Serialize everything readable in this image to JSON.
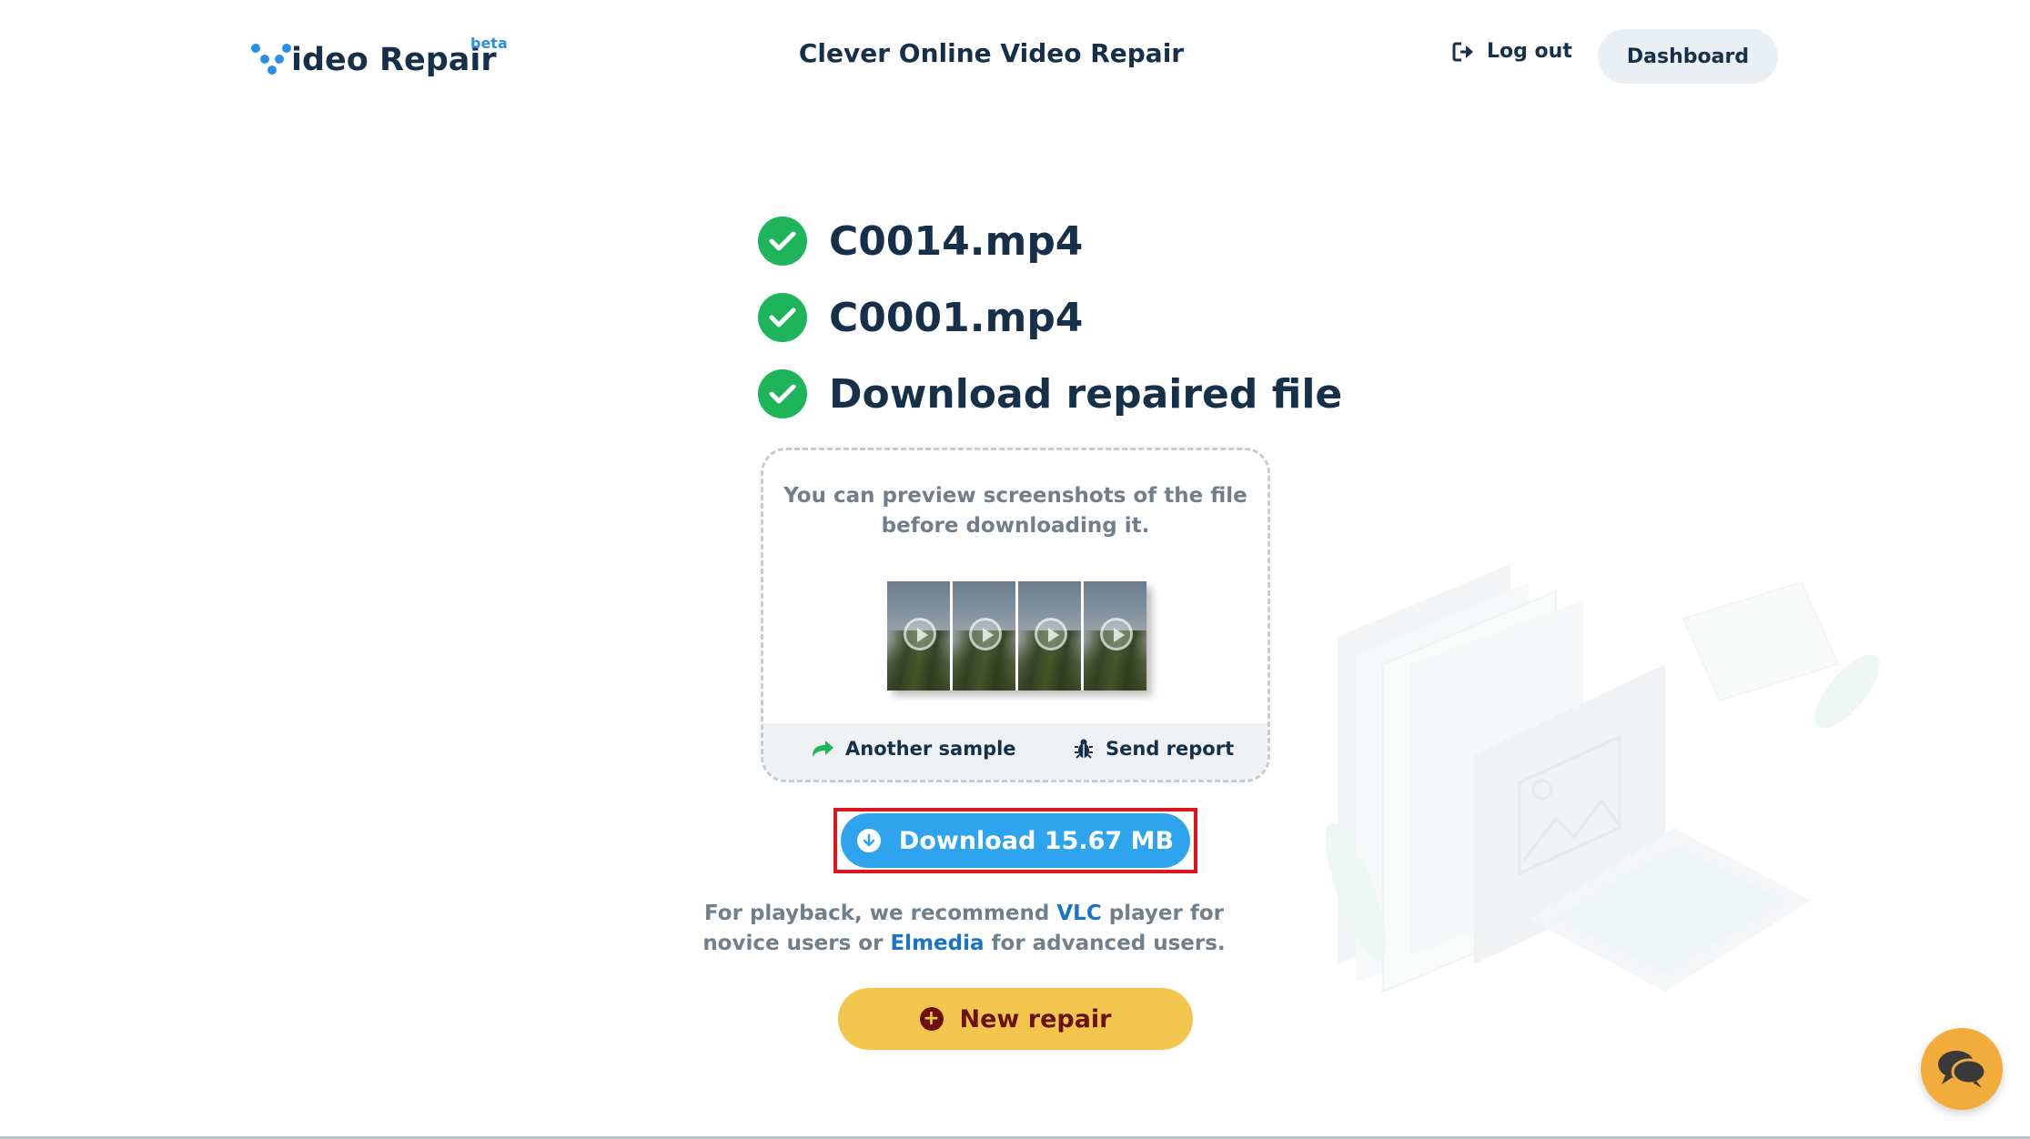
{
  "header": {
    "logo_text": "ideo Repair",
    "logo_beta": "beta",
    "title": "Clever Online Video Repair",
    "logout_label": "Log out",
    "dashboard_label": "Dashboard"
  },
  "steps": [
    {
      "label": "C0014.mp4",
      "status": "done"
    },
    {
      "label": "C0001.mp4",
      "status": "done"
    },
    {
      "label": "Download repaired file",
      "status": "done"
    }
  ],
  "preview": {
    "text_line1": "You can preview screenshots of the file",
    "text_line2": "before downloading it.",
    "another_sample_label": "Another sample",
    "send_report_label": "Send report"
  },
  "download": {
    "label": "Download 15.67 MB"
  },
  "recommend": {
    "part1": "For playback, we recommend ",
    "vlc": "VLC",
    "part2": " player for",
    "part3": "novice users or ",
    "elmedia": "Elmedia",
    "part4": " for advanced users."
  },
  "new_repair": {
    "label": "New repair"
  },
  "colors": {
    "brand_blue": "#2a8fe6",
    "success_green": "#1eb55a",
    "download_blue": "#2ea3ee",
    "highlight_red": "#e0141e",
    "new_repair_yellow": "#f2c64c",
    "chat_orange": "#f2ac3c"
  }
}
